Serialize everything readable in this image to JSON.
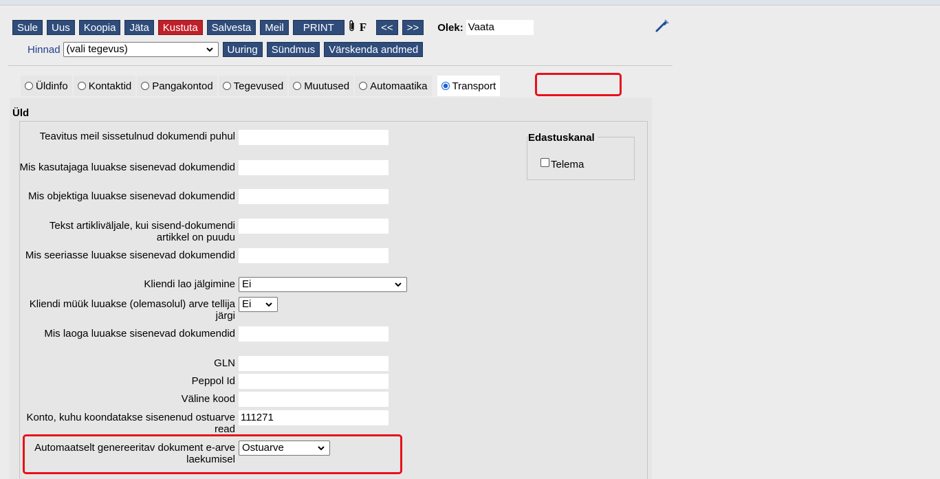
{
  "toolbar": {
    "buttons": [
      "Sule",
      "Uus",
      "Koopia",
      "Jäta",
      "Kustuta",
      "Salvesta",
      "Meil",
      "PRINT"
    ],
    "attach_icon": "paperclip-icon",
    "f_label": "F",
    "prev_label": "<<",
    "next_label": ">>",
    "state_label": "Olek:",
    "state_value": "Vaata",
    "tool_icon": "wrench-icon"
  },
  "row2": {
    "price_link": "Hinnad",
    "action_select": "(vali tegevus)",
    "buttons": [
      "Uuring",
      "Sündmus",
      "Värskenda andmed"
    ]
  },
  "tabs": [
    {
      "label": "Üldinfo",
      "selected": false
    },
    {
      "label": "Kontaktid",
      "selected": false
    },
    {
      "label": "Pangakontod",
      "selected": false
    },
    {
      "label": "Tegevused",
      "selected": false
    },
    {
      "label": "Muutused",
      "selected": false
    },
    {
      "label": "Automaatika",
      "selected": false
    },
    {
      "label": "Transport",
      "selected": true
    }
  ],
  "section": {
    "title": "Üld",
    "fields": [
      {
        "label": "Teavitus meil sissetulnud dokumendi puhul",
        "value": ""
      },
      {
        "label": "Mis kasutajaga luuakse sisenevad dokumendid",
        "value": ""
      },
      {
        "label": "Mis objektiga luuakse sisenevad dokumendid",
        "value": ""
      },
      {
        "label": "Tekst artikliväljale, kui sisend-dokumendi artikkel on puudu",
        "value": ""
      },
      {
        "label": "Mis seeriasse luuakse sisenevad dokumendid",
        "value": ""
      },
      {
        "label": "Kliendi lao jälgimine",
        "value": "Ei"
      },
      {
        "label": "Kliendi müük luuakse (olemasolul) arve tellija järgi",
        "value": "Ei"
      },
      {
        "label": "Mis laoga luuakse sisenevad dokumendid",
        "value": ""
      },
      {
        "label": "GLN",
        "value": ""
      },
      {
        "label": "Peppol Id",
        "value": ""
      },
      {
        "label": "Väline kood",
        "value": ""
      },
      {
        "label": "Konto, kuhu koondatakse sisenenud ostuarve read",
        "value": "111271"
      },
      {
        "label": "Automaatselt genereeritav dokument e-arve laekumisel",
        "value": "Ostuarve"
      }
    ]
  },
  "edastuskanal": {
    "title": "Edastuskanal",
    "option_label": "Telema",
    "checked": false
  },
  "colors": {
    "button_bg": "#2f4c7a",
    "delete_bg": "#c0202a",
    "highlight": "#e8101a",
    "link": "#1f3f8f"
  }
}
